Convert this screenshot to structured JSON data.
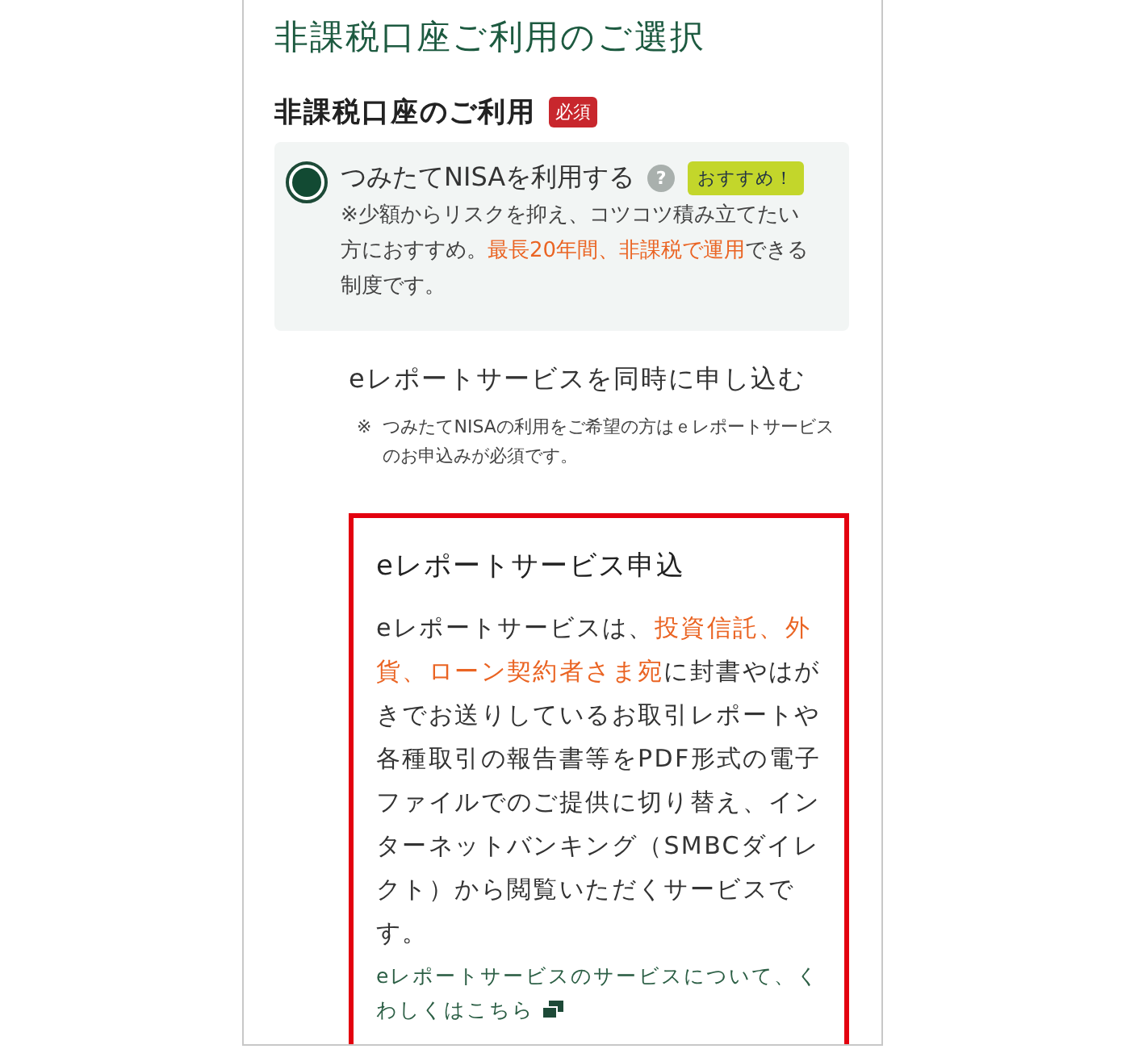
{
  "page_title": "非課税口座ご利用のご選択",
  "section": {
    "title": "非課税口座のご利用",
    "required_badge": "必須"
  },
  "option": {
    "label": "つみたてNISAを利用する",
    "selected": true,
    "help_icon": "?",
    "recommend_badge": "おすすめ！",
    "description": [
      {
        "text": "※少額からリスクを抑え、コツコツ積み立てたい方におすすめ。",
        "highlight": false
      },
      {
        "text": "最長20年間、非課税で運用",
        "highlight": true
      },
      {
        "text": "できる制度です。",
        "highlight": false
      }
    ]
  },
  "ereport": {
    "label": "eレポートサービスを同時に申し込む",
    "note_mark": "※",
    "note": "つみたてNISAの利用をご希望の方はｅレポートサービスのお申込みが必須です。"
  },
  "card": {
    "outlined": true,
    "title": "eレポートサービス申込",
    "body": [
      {
        "text": "eレポートサービスは、",
        "highlight": false
      },
      {
        "text": "投資信託、外貨、ローン契約者さま宛",
        "highlight": true
      },
      {
        "text": "に封書やはがきでお送りしているお取引レポートや各種取引の報告書等をPDF形式の電子ファイルでのご提供に切り替え、インターネットバンキング（SMBCダイレクト）から閲覧いただくサービスです。",
        "highlight": false
      }
    ],
    "link": "eレポートサービスのサービスについて、くわしくはこちら"
  }
}
